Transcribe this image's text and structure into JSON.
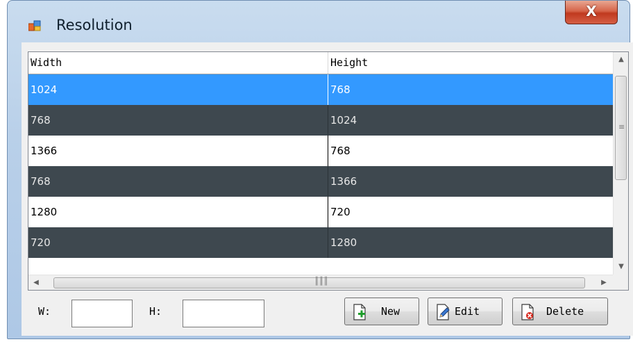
{
  "window": {
    "title": "Resolution",
    "close_label": "X"
  },
  "grid": {
    "columns": [
      "Width",
      "Height"
    ],
    "rows": [
      {
        "width": "1024",
        "height": "768",
        "state": "selected"
      },
      {
        "width": "768",
        "height": "1024",
        "state": "alternate"
      },
      {
        "width": "1366",
        "height": "768",
        "state": "normal"
      },
      {
        "width": "768",
        "height": "1366",
        "state": "alternate"
      },
      {
        "width": "1280",
        "height": "720",
        "state": "normal"
      },
      {
        "width": "720",
        "height": "1280",
        "state": "alternate"
      }
    ]
  },
  "form": {
    "w_label": "W:",
    "w_value": "",
    "h_label": "H:",
    "h_value": ""
  },
  "buttons": {
    "new_label": "New",
    "edit_label": "Edit",
    "delete_label": "Delete"
  },
  "icons": {
    "app": "window-icon",
    "up": "up-arrow-icon",
    "down": "down-arrow-icon",
    "left": "left-arrow-icon",
    "right": "right-arrow-icon",
    "new": "new-document-icon",
    "edit": "edit-pencil-icon",
    "delete": "delete-document-icon"
  },
  "colors": {
    "selected_row": "#3399ff",
    "alternate_row": "#3e484f",
    "normal_row": "#ffffff"
  }
}
